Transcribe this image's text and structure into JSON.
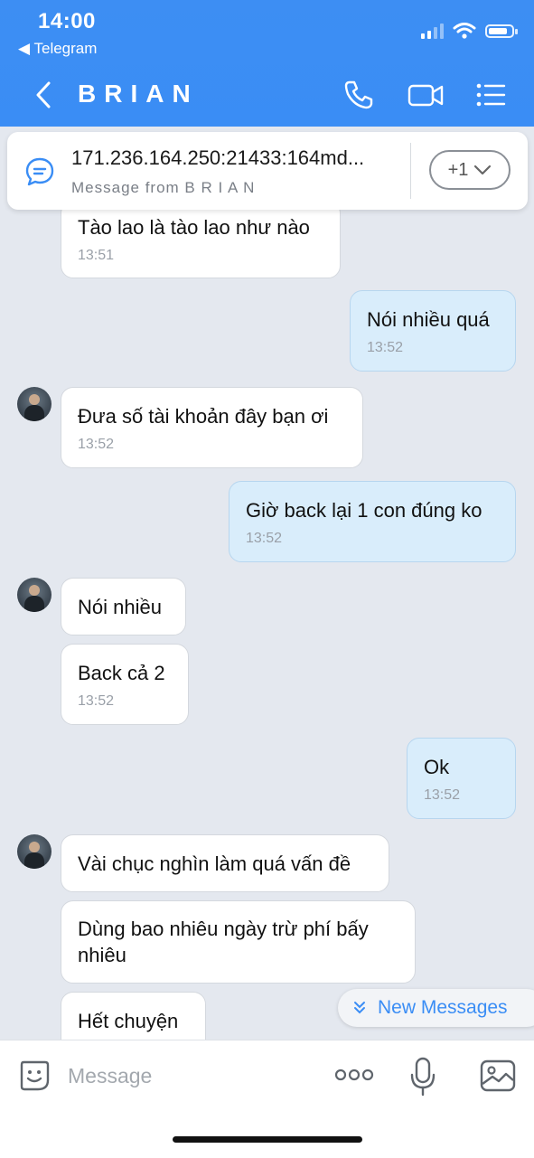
{
  "status_bar": {
    "time": "14:00",
    "back_app": "◀ Telegram"
  },
  "header": {
    "title": "BRIAN"
  },
  "pinned": {
    "text": "171.236.164.250:21433:164md...",
    "subtitle": "Message from B R I A N",
    "more_label": "+1"
  },
  "messages": [
    {
      "side": "in",
      "text": "Tào lao là tào lao như nào",
      "time": "13:51"
    },
    {
      "side": "out",
      "text": "Nói nhiều quá",
      "time": "13:52"
    },
    {
      "side": "in",
      "text": "Đưa số tài khoản đây bạn ơi",
      "time": "13:52"
    },
    {
      "side": "out",
      "text": "Giờ back lại 1 con đúng ko",
      "time": "13:52"
    },
    {
      "side": "in",
      "text": "Nói nhiều",
      "time": ""
    },
    {
      "side": "in",
      "text": "Back cả 2",
      "time": "13:52"
    },
    {
      "side": "out",
      "text": "Ok",
      "time": "13:52"
    },
    {
      "side": "in",
      "text": "Vài chục nghìn làm quá vấn đề",
      "time": ""
    },
    {
      "side": "in",
      "text": "Dùng bao nhiêu ngày trừ phí bấy nhiêu",
      "time": ""
    },
    {
      "side": "in",
      "text": "Hết chuyện",
      "time": ""
    }
  ],
  "new_messages_label": "New Messages",
  "composer": {
    "placeholder": "Message"
  },
  "colors": {
    "accent": "#3a8df5",
    "outgoing_bubble": "#d9edfb",
    "incoming_bubble": "#ffffff",
    "background": "#e4e8ef"
  }
}
